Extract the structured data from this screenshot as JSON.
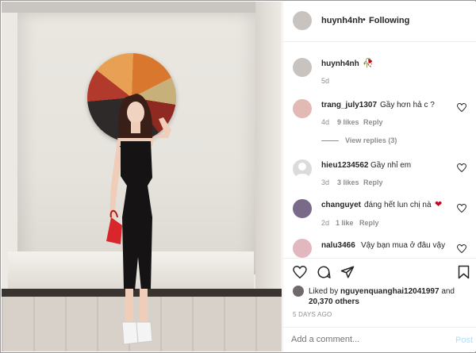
{
  "post": {
    "author": "huynh4nh",
    "follow_separator": "•",
    "follow_status": "Following"
  },
  "caption": {
    "author": "huynh4nh",
    "emoji": "🥀",
    "time": "5d"
  },
  "comments": [
    {
      "user": "trang_july1307",
      "text": "Gầy hơn hả c ?",
      "time": "4d",
      "likes": "9 likes",
      "reply": "Reply",
      "view_replies": "View replies (3)"
    },
    {
      "user": "hieu1234562",
      "text": "Gầy nhỉ em",
      "time": "3d",
      "likes": "3 likes",
      "reply": "Reply"
    },
    {
      "user": "changuyet",
      "text": "đáng hết lun chị nà",
      "emoji": "❤",
      "time": "2d",
      "likes": "1 like",
      "reply": "Reply"
    },
    {
      "user": "nalu3466",
      "text": "Vậy bạn mua ở đâu vậy"
    }
  ],
  "likes": {
    "prefix": "Liked by",
    "user": "nguyenquanghai12041997",
    "and": "and",
    "others": "20,370 others"
  },
  "timestamp": "5 DAYS AGO",
  "add_comment": {
    "placeholder": "Add a comment...",
    "post_label": "Post"
  },
  "colors": {
    "link": "#262626",
    "muted": "#8e8e8e",
    "post_disabled": "#b2dffc",
    "heart_red": "#d0021b"
  },
  "icons": [
    "heart-icon",
    "comment-icon",
    "share-icon",
    "bookmark-icon"
  ]
}
